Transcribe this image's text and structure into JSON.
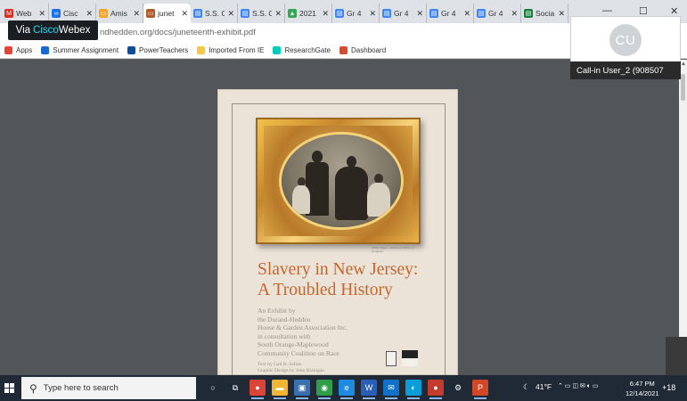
{
  "browser": {
    "tabs": [
      {
        "label": "Web",
        "color": "#d93025",
        "glyph": "M"
      },
      {
        "label": "Cisc",
        "color": "#1a73e8",
        "glyph": "∞"
      },
      {
        "label": "Amis",
        "color": "#f4a62a",
        "glyph": "▭"
      },
      {
        "label": "junet",
        "color": "#b05a2a",
        "glyph": "▭",
        "active": true
      },
      {
        "label": "S.S. C",
        "color": "#4285f4",
        "glyph": "▤"
      },
      {
        "label": "S.S. C",
        "color": "#4285f4",
        "glyph": "▤"
      },
      {
        "label": "2021",
        "color": "#34a853",
        "glyph": "▲"
      },
      {
        "label": "Gr 4",
        "color": "#4285f4",
        "glyph": "▤"
      },
      {
        "label": "Gr 4",
        "color": "#4285f4",
        "glyph": "▤"
      },
      {
        "label": "Gr 4",
        "color": "#4285f4",
        "glyph": "▤"
      },
      {
        "label": "Gr 4",
        "color": "#4285f4",
        "glyph": "▤"
      },
      {
        "label": "Socia",
        "color": "#188038",
        "glyph": "▤"
      }
    ],
    "url_visible": "ndhedden.org/docs/juneteenth-exhibit.pdf",
    "bookmarks": [
      {
        "label": "Apps",
        "color": "#ea4335"
      },
      {
        "label": "Summer Assignment",
        "color": "#1967d2"
      },
      {
        "label": "PowerTeachers",
        "color": "#0b4f9c"
      },
      {
        "label": "Imported From IE",
        "color": "#f6c744"
      },
      {
        "label": "ResearchGate",
        "color": "#00ccbb"
      },
      {
        "label": "Dashboard",
        "color": "#d94a2b"
      }
    ],
    "window_controls": [
      "—",
      "☐",
      "✕"
    ]
  },
  "webex": {
    "via": "Via",
    "brand": "Cisco",
    "product": "Webex",
    "participant_initials": "CU",
    "participant_name": "Call-in User_2 (908507"
  },
  "pdf": {
    "title_line1": "Slavery in New Jersey:",
    "title_line2": "A Troubled History",
    "subtitle_lines": [
      "An Exhibit by",
      "the Durand-Hedden",
      "House & Garden Association Inc.",
      "in consultation with",
      "South Orange-Maplewood",
      "Community Coalition on Race"
    ],
    "credit_lines": [
      "Text by Gail R. Safian",
      "Graphic Design by John Branigan"
    ],
    "photo_caption": "1860s tintype, courtesy of Library of Congress"
  },
  "taskbar": {
    "search_placeholder": "Type here to search",
    "temperature": "41°F",
    "time": "6:47 PM",
    "date": "12/14/2021",
    "extra": "+18",
    "apps": [
      {
        "name": "cortana-circle-icon",
        "color": "transparent",
        "glyph": "○"
      },
      {
        "name": "task-view-icon",
        "color": "transparent",
        "glyph": "⧉"
      },
      {
        "name": "chrome-icon",
        "color": "#db4437",
        "glyph": "●"
      },
      {
        "name": "file-explorer-icon",
        "color": "#f2b632",
        "glyph": "▬"
      },
      {
        "name": "store-icon",
        "color": "#3a6fb0",
        "glyph": "▣"
      },
      {
        "name": "maps-icon",
        "color": "#2e9e48",
        "glyph": "◉"
      },
      {
        "name": "edge-icon",
        "color": "#1d8ce0",
        "glyph": "e"
      },
      {
        "name": "word-icon",
        "color": "#2b5fb7",
        "glyph": "W"
      },
      {
        "name": "mail-icon",
        "color": "#1170c8",
        "glyph": "✉"
      },
      {
        "name": "webex-icon",
        "color": "#0b9dd8",
        "glyph": "◐"
      },
      {
        "name": "chrome-alt-icon",
        "color": "#c23b2d",
        "glyph": "●"
      },
      {
        "name": "settings-icon",
        "color": "transparent",
        "glyph": "⚙"
      },
      {
        "name": "powerpoint-icon",
        "color": "#d24726",
        "glyph": "P"
      }
    ]
  }
}
